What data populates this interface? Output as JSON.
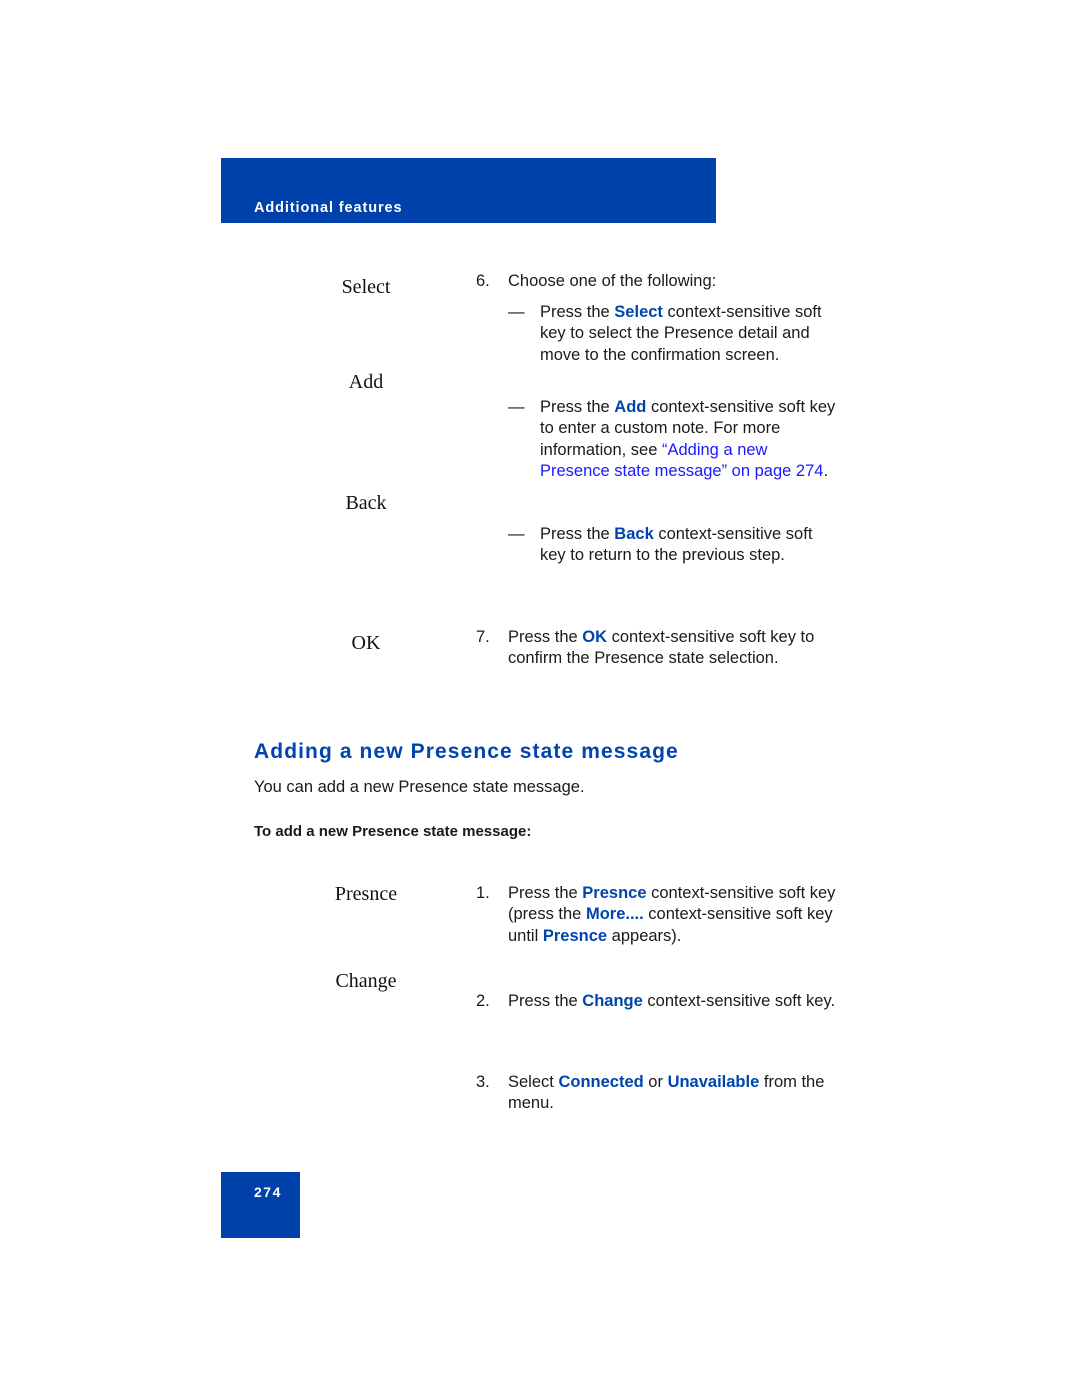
{
  "header": {
    "section": "Additional features"
  },
  "softkeys_top": {
    "select": "Select",
    "add": "Add",
    "back": "Back",
    "ok": "OK"
  },
  "step6": {
    "num": "6.",
    "text": "Choose one of the following:",
    "options": [
      {
        "dash": "—",
        "pre": "Press the ",
        "key": "Select",
        "post": " context-sensitive soft key to select the Presence detail and move to the confirmation screen."
      },
      {
        "dash": "—",
        "pre": "Press the ",
        "key": "Add",
        "post": " context-sensitive soft key to enter a custom note. For more information, see ",
        "link": "“Adding a new Presence state message” on page 274",
        "after": "."
      },
      {
        "dash": "—",
        "pre": "Press the ",
        "key": "Back",
        "post": " context-sensitive soft key to return to the previous step."
      }
    ]
  },
  "step7": {
    "num": "7.",
    "pre": "Press the ",
    "key": "OK",
    "post": " context-sensitive soft key to confirm the Presence state selection."
  },
  "section": {
    "title": "Adding a new Presence state message",
    "intro": "You can add a new Presence state message.",
    "procedure_title": "To add a new Presence state message:"
  },
  "softkeys_bottom": {
    "presnce": "Presnce",
    "change": "Change"
  },
  "steps": [
    {
      "num": "1.",
      "pre": "Press the ",
      "key": "Presnce",
      "mid": " context-sensitive soft key (press the ",
      "key2": "More....",
      "mid2": " context-sensitive soft key until ",
      "key3": "Presnce",
      "post": " appears)."
    },
    {
      "num": "2.",
      "pre": "Press the ",
      "key": "Change",
      "post": " context-sensitive soft key."
    },
    {
      "num": "3.",
      "pre": "Select ",
      "key": "Connected",
      "mid": " or ",
      "key2": "Unavailable",
      "post": " from the menu."
    }
  ],
  "footer": {
    "page_number": "274"
  },
  "colors": {
    "brand_blue": "#0041ab",
    "keyword_blue": "#0045ad",
    "link_blue": "#1a1aff"
  }
}
